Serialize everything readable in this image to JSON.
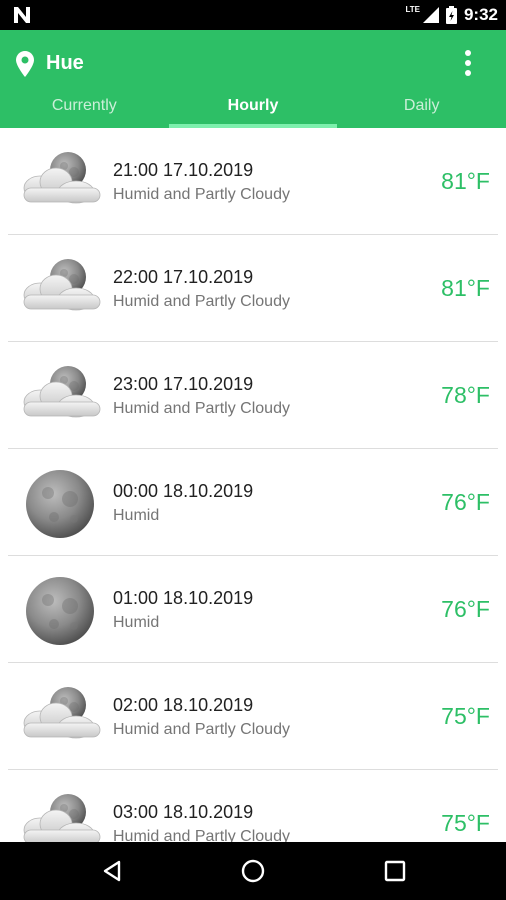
{
  "status_bar": {
    "network": "LTE",
    "time": "9:32",
    "icons": [
      "notification-n-icon",
      "signal-icon",
      "battery-icon"
    ]
  },
  "header": {
    "location": "Hue",
    "icons": [
      "location-pin-icon",
      "overflow-menu-icon"
    ]
  },
  "tabs": [
    {
      "label": "Currently",
      "active": false
    },
    {
      "label": "Hourly",
      "active": true
    },
    {
      "label": "Daily",
      "active": false
    }
  ],
  "hourly": [
    {
      "time": "21:00 17.10.2019",
      "summary": "Humid and Partly Cloudy",
      "temp": "81°F",
      "icon": "partly-cloudy-night-icon"
    },
    {
      "time": "22:00 17.10.2019",
      "summary": "Humid and Partly Cloudy",
      "temp": "81°F",
      "icon": "partly-cloudy-night-icon"
    },
    {
      "time": "23:00 17.10.2019",
      "summary": "Humid and Partly Cloudy",
      "temp": "78°F",
      "icon": "partly-cloudy-night-icon"
    },
    {
      "time": "00:00 18.10.2019",
      "summary": "Humid",
      "temp": "76°F",
      "icon": "clear-night-moon-icon"
    },
    {
      "time": "01:00 18.10.2019",
      "summary": "Humid",
      "temp": "76°F",
      "icon": "clear-night-moon-icon"
    },
    {
      "time": "02:00 18.10.2019",
      "summary": "Humid and Partly Cloudy",
      "temp": "75°F",
      "icon": "partly-cloudy-night-icon"
    },
    {
      "time": "03:00 18.10.2019",
      "summary": "Humid and Partly Cloudy",
      "temp": "75°F",
      "icon": "partly-cloudy-night-icon"
    }
  ],
  "colors": {
    "accent": "#2dbf66",
    "tab_indicator": "#7df0ad",
    "primary_text": "#212121",
    "secondary_text": "#757575"
  },
  "nav_bar": {
    "icons": [
      "back-icon",
      "home-icon",
      "recents-icon"
    ]
  }
}
